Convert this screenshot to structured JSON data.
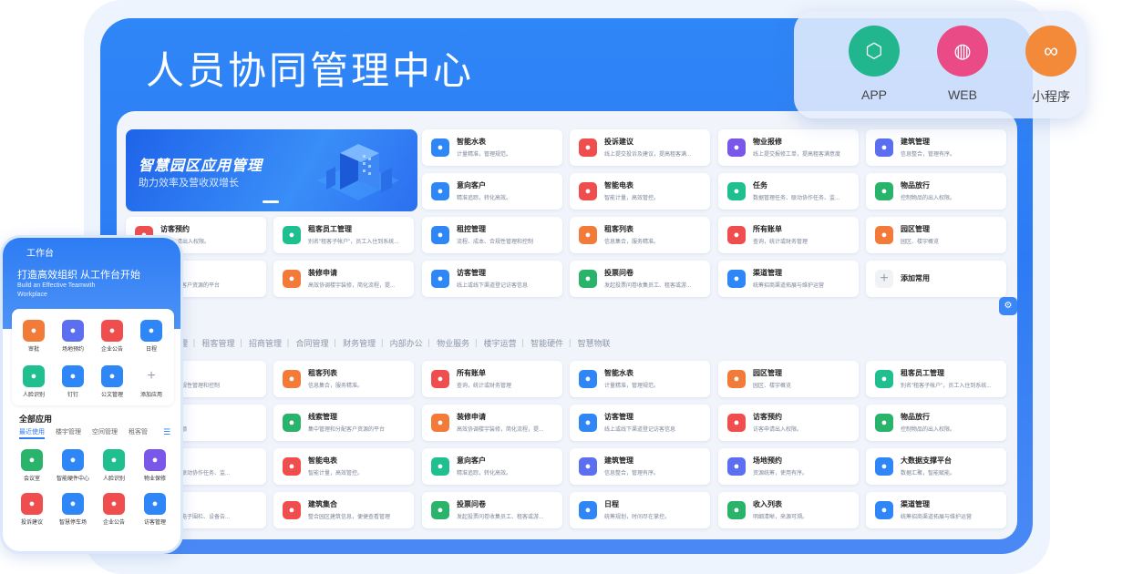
{
  "header": {
    "title": "人员协同管理中心"
  },
  "banner": {
    "title": "智慧园区应用管理",
    "subtitle": "助力效率及营收双增长"
  },
  "platforms": [
    {
      "label": "APP",
      "icon": "cube-icon",
      "color": "#22b68f"
    },
    {
      "label": "WEB",
      "icon": "globe-icon",
      "color": "#ea4b86"
    },
    {
      "label": "小程序",
      "icon": "link-icon",
      "color": "#f28a3a"
    }
  ],
  "top_cards": [
    {
      "title": "智能水表",
      "desc": "计量精准，管理规范。",
      "color": "#2f86f6",
      "icon": "water-icon"
    },
    {
      "title": "投诉建议",
      "desc": "线上提交投诉及建议，提高租客满...",
      "color": "#f04e4e",
      "icon": "complaint-icon"
    },
    {
      "title": "物业报修",
      "desc": "线上提交报修工单，提高租客满意度",
      "color": "#7a57e8",
      "icon": "repair-icon"
    },
    {
      "title": "建筑管理",
      "desc": "信息整合，管理有序。",
      "color": "#5b6ff0",
      "icon": "building-icon"
    },
    {
      "title": "意向客户",
      "desc": "精准追踪，转化高效。",
      "color": "#2f86f6",
      "icon": "customer-icon"
    },
    {
      "title": "智能电表",
      "desc": "智能计量，高效管控。",
      "color": "#f04e4e",
      "icon": "meter-icon"
    },
    {
      "title": "任务",
      "desc": "数据管理任务、联动协作任务、监...",
      "color": "#1fbf8f",
      "icon": "task-icon"
    },
    {
      "title": "物品放行",
      "desc": "控制物品的出入权限。",
      "color": "#29b36b",
      "icon": "release-icon"
    },
    {
      "title": "访客预约",
      "desc": "访客申请出入权限。",
      "color": "#f04e4e",
      "icon": "visitor-icon"
    },
    {
      "title": "租客员工管理",
      "desc": "别名\"租客子帐户\"，员工入住到系统...",
      "color": "#1fbf8f",
      "icon": "staff-icon"
    },
    {
      "title": "租控管理",
      "desc": "流程、成本、合规性管理和控制",
      "color": "#2f86f6",
      "icon": "rent-icon"
    },
    {
      "title": "租客列表",
      "desc": "信息集合，服务精准。",
      "color": "#f27b3a",
      "icon": "tenant-icon"
    },
    {
      "title": "所有账单",
      "desc": "查询，统计或财务管理",
      "color": "#f04e4e",
      "icon": "bill-icon"
    },
    {
      "title": "园区管理",
      "desc": "园区、楼宇概览",
      "color": "#f27b3a",
      "icon": "park-icon"
    },
    {
      "title": "",
      "desc": "...和分配客户资源的平台",
      "color": "#2f86f6",
      "icon": "clue-icon"
    },
    {
      "title": "装修申请",
      "desc": "高效协调楼宇装修，简化流程，提...",
      "color": "#f27b3a",
      "icon": "decor-icon"
    },
    {
      "title": "访客管理",
      "desc": "线上或线下渠道登记访客信息",
      "color": "#2f86f6",
      "icon": "visitor-mgmt-icon"
    },
    {
      "title": "投票问卷",
      "desc": "发起投票问卷收集员工、租客或游...",
      "color": "#29b36b",
      "icon": "vote-icon"
    },
    {
      "title": "渠道管理",
      "desc": "统筹招商渠道拓展与维护运营",
      "color": "#2f86f6",
      "icon": "channel-icon"
    },
    {
      "title": "添加常用",
      "desc": "",
      "color": "#f0f2f6",
      "icon": "plus-icon"
    }
  ],
  "category_tabs": [
    "管理",
    "租客管理",
    "招商管理",
    "合同管理",
    "财务管理",
    "内部办公",
    "物业服务",
    "楼宇运营",
    "智能硬件",
    "智慧物联"
  ],
  "bottom_cards": [
    {
      "title": "",
      "desc": "...本、合规性管理和控制",
      "color": "#2f86f6",
      "icon": "rent-icon"
    },
    {
      "title": "租客列表",
      "desc": "信息集合，服务精准。",
      "color": "#f27b3a",
      "icon": "tenant-icon"
    },
    {
      "title": "所有账单",
      "desc": "查询，统计或财务管理",
      "color": "#f04e4e",
      "icon": "bill-icon"
    },
    {
      "title": "智能水表",
      "desc": "计量精准，管理规范。",
      "color": "#2f86f6",
      "icon": "water-icon"
    },
    {
      "title": "园区管理",
      "desc": "园区、楼宇概览",
      "color": "#f27b3a",
      "icon": "park-icon"
    },
    {
      "title": "租客员工管理",
      "desc": "别名\"租客子帐户\"，员工入住到系统...",
      "color": "#1fbf8f",
      "icon": "staff-icon"
    },
    {
      "title": "",
      "desc": "...额、金额",
      "color": "#2f86f6",
      "icon": "table-icon"
    },
    {
      "title": "线索管理",
      "desc": "集中管理和分配客户资源的平台",
      "color": "#29b36b",
      "icon": "clue-icon"
    },
    {
      "title": "装修申请",
      "desc": "高效协调楼宇装修，简化流程，提...",
      "color": "#f27b3a",
      "icon": "decor-icon"
    },
    {
      "title": "访客管理",
      "desc": "线上或线下渠道登记访客信息",
      "color": "#2f86f6",
      "icon": "visitor-mgmt-icon"
    },
    {
      "title": "访客预约",
      "desc": "访客申请出入权限。",
      "color": "#f04e4e",
      "icon": "visitor-icon"
    },
    {
      "title": "物品放行",
      "desc": "控制物品的出入权限。",
      "color": "#29b36b",
      "icon": "release-icon"
    },
    {
      "title": "",
      "desc": "...任务、联动协作任务、监...",
      "color": "#1fbf8f",
      "icon": "task-icon"
    },
    {
      "title": "智能电表",
      "desc": "智能计量，高效管控。",
      "color": "#f04e4e",
      "icon": "meter-icon"
    },
    {
      "title": "意向客户",
      "desc": "精准追踪，转化高效。",
      "color": "#1fbf8f",
      "icon": "customer-icon"
    },
    {
      "title": "建筑管理",
      "desc": "信息整合，管理有序。",
      "color": "#5b6ff0",
      "icon": "building-icon"
    },
    {
      "title": "场地预约",
      "desc": "资源统筹，使用有序。",
      "color": "#5b6ff0",
      "icon": "venue-icon"
    },
    {
      "title": "大数据支撑平台",
      "desc": "数据汇聚，智能赋能。",
      "color": "#2f86f6",
      "icon": "data-icon"
    },
    {
      "title": "",
      "desc": "...管理、电子围栏、设备告...",
      "color": "#2f86f6",
      "icon": "device-icon"
    },
    {
      "title": "建筑集合",
      "desc": "整合园区建筑信息，便捷查看管理",
      "color": "#f04e4e",
      "icon": "building-set-icon"
    },
    {
      "title": "投票问卷",
      "desc": "发起投票问卷收集员工、租客或游...",
      "color": "#29b36b",
      "icon": "vote-icon"
    },
    {
      "title": "日程",
      "desc": "统筹规划，时间尽在掌控。",
      "color": "#2f86f6",
      "icon": "calendar-icon"
    },
    {
      "title": "收入列表",
      "desc": "明细清晰，来源可溯。",
      "color": "#29b36b",
      "icon": "income-icon"
    },
    {
      "title": "渠道管理",
      "desc": "统筹招商渠道拓展与维护运营",
      "color": "#2f86f6",
      "icon": "channel-icon"
    }
  ],
  "phone": {
    "app_title": "工作台",
    "slogan": "打造高效组织 从工作台开始",
    "slogan_en": "Build an Effective Teamwith Workplace",
    "quick": [
      {
        "label": "审批",
        "color": "#f27b3a",
        "icon": "approve-icon"
      },
      {
        "label": "场地预约",
        "color": "#5b6ff0",
        "icon": "venue-icon"
      },
      {
        "label": "企业公告",
        "color": "#f04e4e",
        "icon": "announce-icon"
      },
      {
        "label": "日程",
        "color": "#2f86f6",
        "icon": "calendar-icon"
      },
      {
        "label": "人脸识别",
        "color": "#1fbf8f",
        "icon": "face-icon"
      },
      {
        "label": "钉钉",
        "color": "#2f86f6",
        "icon": "dingtalk-icon"
      },
      {
        "label": "公文管理",
        "color": "#2f86f6",
        "icon": "doc-icon"
      },
      {
        "label": "添加应用",
        "color": "#f0f2f6",
        "icon": "plus-icon"
      }
    ],
    "all_title": "全部应用",
    "tabs": [
      "最近使用",
      "楼宇管理",
      "空间管理",
      "租客管"
    ],
    "apps": [
      {
        "label": "会议室",
        "color": "#29b36b",
        "icon": "meeting-icon"
      },
      {
        "label": "智能硬件中心",
        "color": "#2f86f6",
        "icon": "hardware-icon"
      },
      {
        "label": "人脸识别",
        "color": "#1fbf8f",
        "icon": "face-icon"
      },
      {
        "label": "物业保修",
        "color": "#7a57e8",
        "icon": "repair-icon"
      },
      {
        "label": "投诉建议",
        "color": "#f04e4e",
        "icon": "complaint-icon"
      },
      {
        "label": "智慧停车场",
        "color": "#2f86f6",
        "icon": "parking-icon"
      },
      {
        "label": "企业公告",
        "color": "#f04e4e",
        "icon": "announce-icon"
      },
      {
        "label": "访客管理",
        "color": "#2f86f6",
        "icon": "visitor-mgmt-icon"
      }
    ]
  }
}
